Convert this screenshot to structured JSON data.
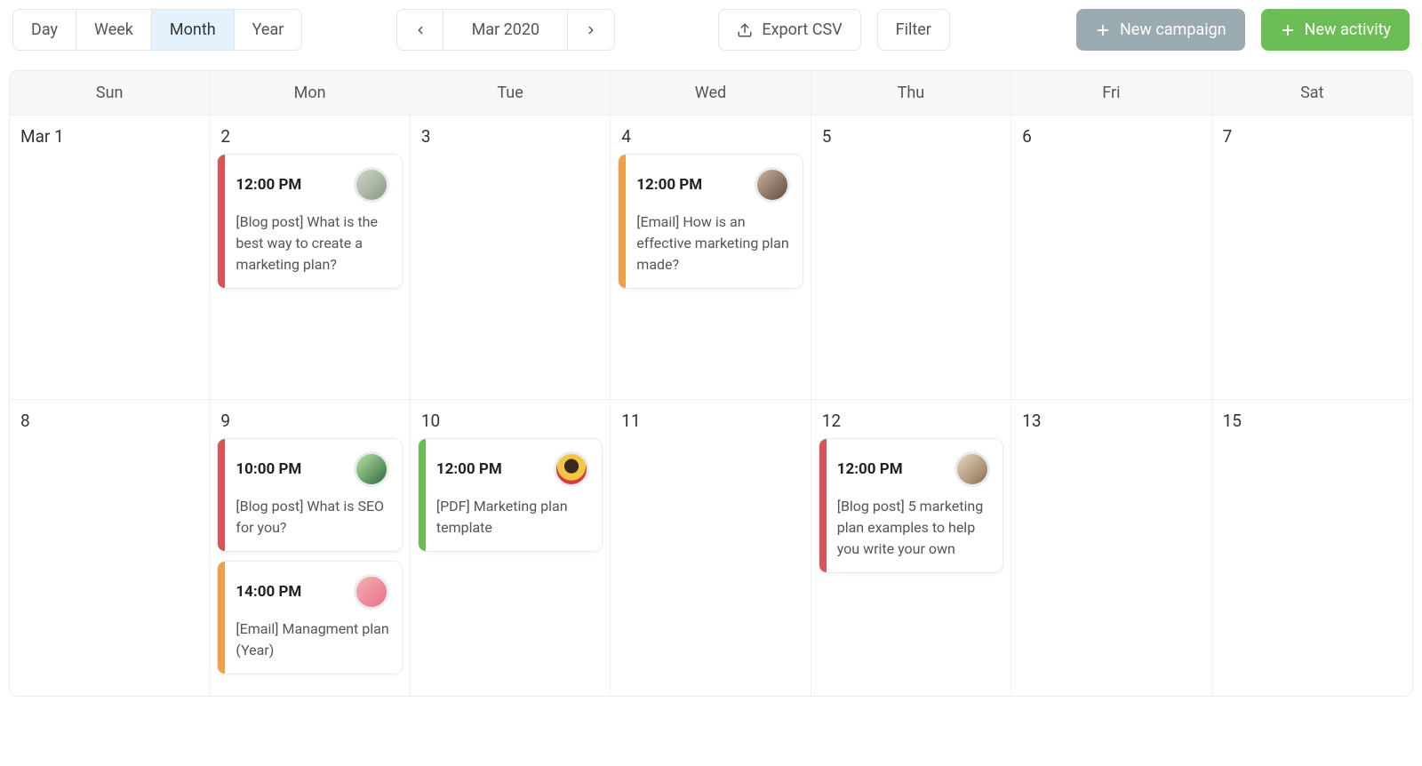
{
  "toolbar": {
    "views": [
      "Day",
      "Week",
      "Month",
      "Year"
    ],
    "active_view_index": 2,
    "period_label": "Mar 2020",
    "export_label": "Export CSV",
    "filter_label": "Filter",
    "new_campaign_label": "New campaign",
    "new_activity_label": "New activity"
  },
  "calendar": {
    "days_of_week": [
      "Sun",
      "Mon",
      "Tue",
      "Wed",
      "Thu",
      "Fri",
      "Sat"
    ],
    "weeks": [
      {
        "days": [
          {
            "label": "Mar 1",
            "events": []
          },
          {
            "label": "2",
            "events": [
              {
                "time": "12:00 PM",
                "title": "[Blog post] What is the best way to create a marketing plan?",
                "color": "red",
                "avatar": "a1"
              }
            ]
          },
          {
            "label": "3",
            "events": []
          },
          {
            "label": "4",
            "events": [
              {
                "time": "12:00 PM",
                "title": "[Email] How is an effective marketing plan made?",
                "color": "orange",
                "avatar": "a2"
              }
            ]
          },
          {
            "label": "5",
            "events": []
          },
          {
            "label": "6",
            "events": []
          },
          {
            "label": "7",
            "events": []
          }
        ]
      },
      {
        "days": [
          {
            "label": "8",
            "events": []
          },
          {
            "label": "9",
            "events": [
              {
                "time": "10:00 PM",
                "title": "[Blog post] What is SEO for you?",
                "color": "red",
                "avatar": "a3"
              },
              {
                "time": "14:00 PM",
                "title": "[Email] Managment plan (Year)",
                "color": "orange",
                "avatar": "a4"
              }
            ]
          },
          {
            "label": "10",
            "events": [
              {
                "time": "12:00 PM",
                "title": "[PDF] Marketing plan template",
                "color": "green",
                "avatar": "a5"
              }
            ]
          },
          {
            "label": "11",
            "events": []
          },
          {
            "label": "12",
            "events": [
              {
                "time": "12:00 PM",
                "title": "[Blog post] 5 marketing plan examples to help you write your own",
                "color": "red",
                "avatar": "a6"
              }
            ]
          },
          {
            "label": "13",
            "events": []
          },
          {
            "label": "15",
            "events": []
          }
        ]
      }
    ]
  }
}
